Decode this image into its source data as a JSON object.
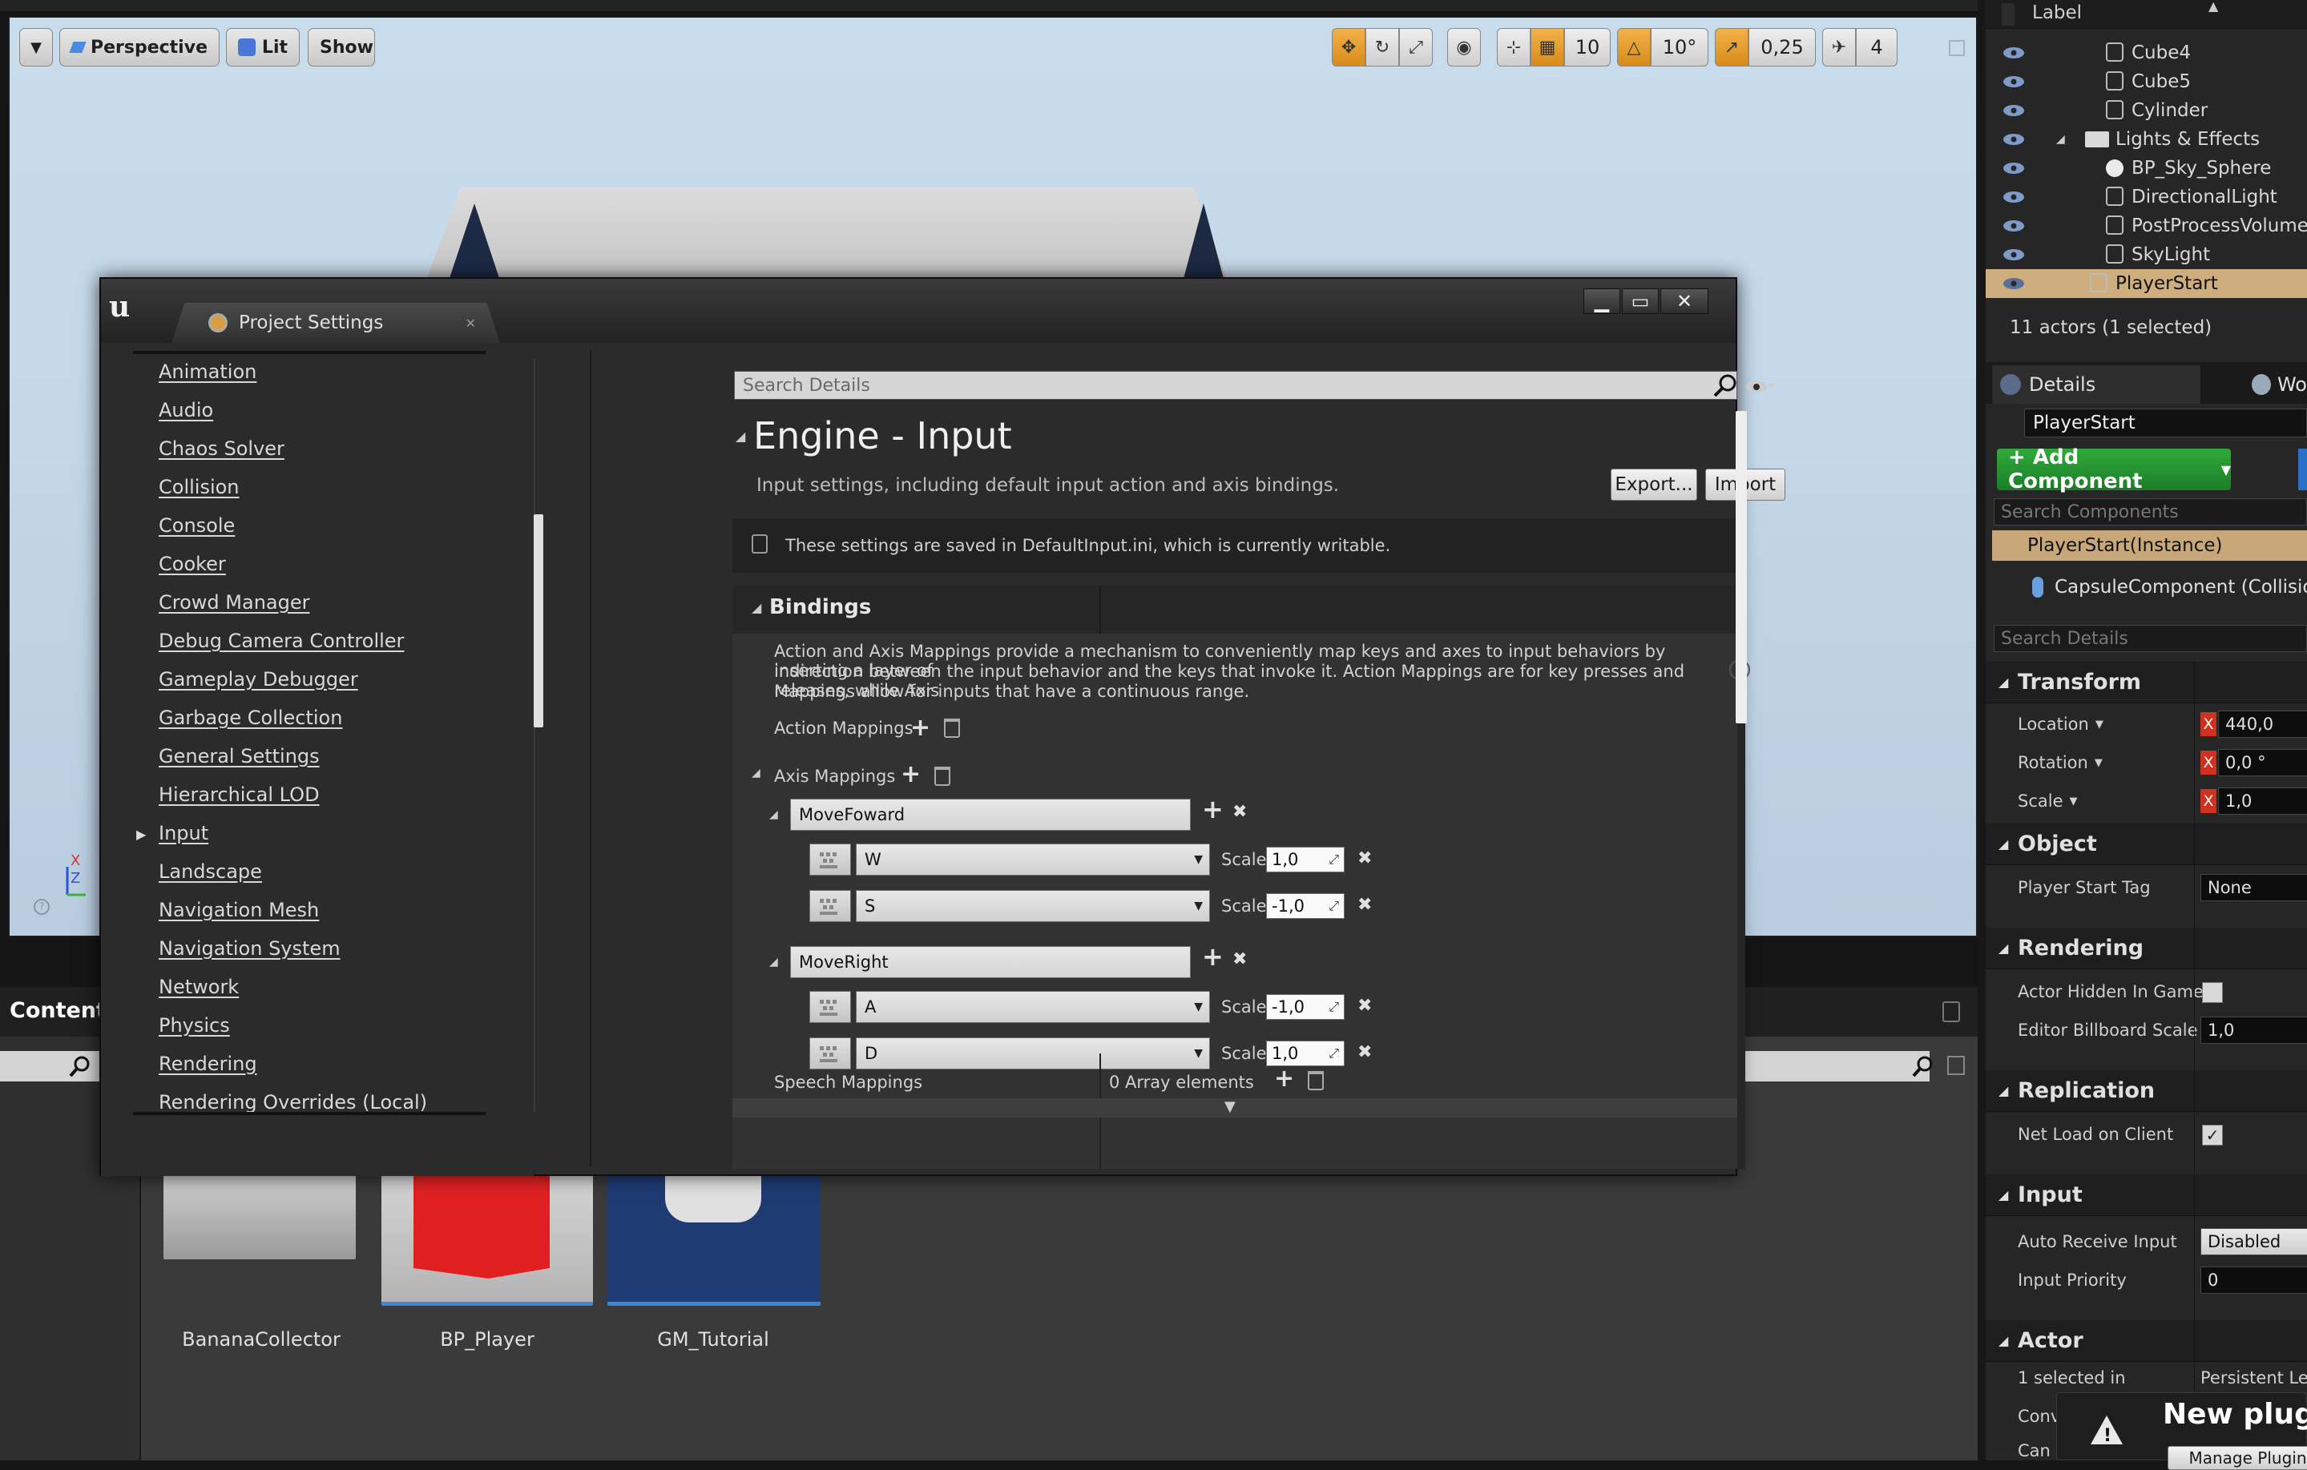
{
  "viewport": {
    "perspective": "Perspective",
    "lit": "Lit",
    "show": "Show",
    "grid_snap": "10",
    "rot_snap": "10°",
    "scale_snap": "0,25",
    "cam_speed": "4"
  },
  "content_browser": {
    "title": "Content",
    "assets": [
      {
        "name": "BananaCollector"
      },
      {
        "name": "BP_Player"
      },
      {
        "name": "GM_Tutorial"
      }
    ]
  },
  "outliner": {
    "header": "Label",
    "items": [
      {
        "label": "Cube4",
        "indent": 2,
        "icon": "actor-icon"
      },
      {
        "label": "Cube5",
        "indent": 2,
        "icon": "actor-icon"
      },
      {
        "label": "Cylinder",
        "indent": 2,
        "icon": "actor-icon"
      },
      {
        "label": "Lights & Effects",
        "indent": 1,
        "icon": "folder-icon"
      },
      {
        "label": "BP_Sky_Sphere",
        "indent": 2,
        "icon": "sphere-icon"
      },
      {
        "label": "DirectionalLight",
        "indent": 2,
        "icon": "light-icon"
      },
      {
        "label": "PostProcessVolume",
        "indent": 2,
        "icon": "volume-icon"
      },
      {
        "label": "SkyLight",
        "indent": 2,
        "icon": "skylight-icon"
      },
      {
        "label": "PlayerStart",
        "indent": 1,
        "icon": "playerstart-icon",
        "selected": true
      }
    ],
    "footer": "11 actors (1 selected)"
  },
  "details": {
    "tab": "Details",
    "tab2": "Wo",
    "actor_name": "PlayerStart",
    "add_component": "+ Add Component",
    "search_components_placeholder": "Search Components",
    "instance": "PlayerStart(Instance)",
    "capsule": "CapsuleComponent (Collision)",
    "search_details_placeholder": "Search Details",
    "transform": {
      "title": "Transform",
      "location": "Location",
      "location_val": "440,0",
      "rotation": "Rotation",
      "rotation_val": "0,0 °",
      "scale": "Scale",
      "scale_val": "1,0"
    },
    "object": {
      "title": "Object",
      "player_start_tag": "Player Start Tag",
      "player_start_tag_val": "None"
    },
    "rendering": {
      "title": "Rendering",
      "hidden": "Actor Hidden In Game",
      "billboard": "Editor Billboard Scale",
      "billboard_val": "1,0"
    },
    "replication": {
      "title": "Replication",
      "net_load": "Net Load on Client"
    },
    "input": {
      "title": "Input",
      "auto_receive": "Auto Receive Input",
      "auto_receive_val": "Disabled",
      "priority": "Input Priority",
      "priority_val": "0"
    },
    "actor": {
      "title": "Actor",
      "selected_in": "1 selected in",
      "selected_in_val": "Persistent Level",
      "conv": "Conv",
      "canb": "Can b"
    },
    "notification": {
      "title": "New plugi",
      "button": "Manage Plugin"
    }
  },
  "dialog": {
    "tab_title": "Project Settings",
    "nav": [
      "Animation",
      "Audio",
      "Chaos Solver",
      "Collision",
      "Console",
      "Cooker",
      "Crowd Manager",
      "Debug Camera Controller",
      "Gameplay Debugger",
      "Garbage Collection",
      "General Settings",
      "Hierarchical LOD",
      "Input",
      "Landscape",
      "Navigation Mesh",
      "Navigation System",
      "Network",
      "Physics",
      "Rendering",
      "Rendering Overrides (Local)"
    ],
    "search_placeholder": "Search Details",
    "heading": "Engine - Input",
    "subtitle": "Input settings, including default input action and axis bindings.",
    "export": "Export...",
    "import": "Import",
    "notice": "These settings are saved in DefaultInput.ini, which is currently writable.",
    "bindings": "Bindings",
    "bindings_desc1": "Action and Axis Mappings provide a mechanism to conveniently map keys and axes to input behaviors by inserting a layer of",
    "bindings_desc2": "indirection between the input behavior and the keys that invoke it. Action Mappings are for key presses and releases, while Axis",
    "bindings_desc3": "Mappings allow for inputs that have a continuous range.",
    "action_mappings": "Action Mappings",
    "axis_mappings": "Axis Mappings",
    "scale_label": "Scale",
    "axes": [
      {
        "name": "MoveFoward",
        "keys": [
          {
            "key": "W",
            "scale": "1,0"
          },
          {
            "key": "S",
            "scale": "-1,0"
          }
        ]
      },
      {
        "name": "MoveRight",
        "keys": [
          {
            "key": "A",
            "scale": "-1,0"
          },
          {
            "key": "D",
            "scale": "1,0"
          }
        ]
      }
    ],
    "speech_mappings": "Speech Mappings",
    "speech_count": "0 Array elements"
  }
}
